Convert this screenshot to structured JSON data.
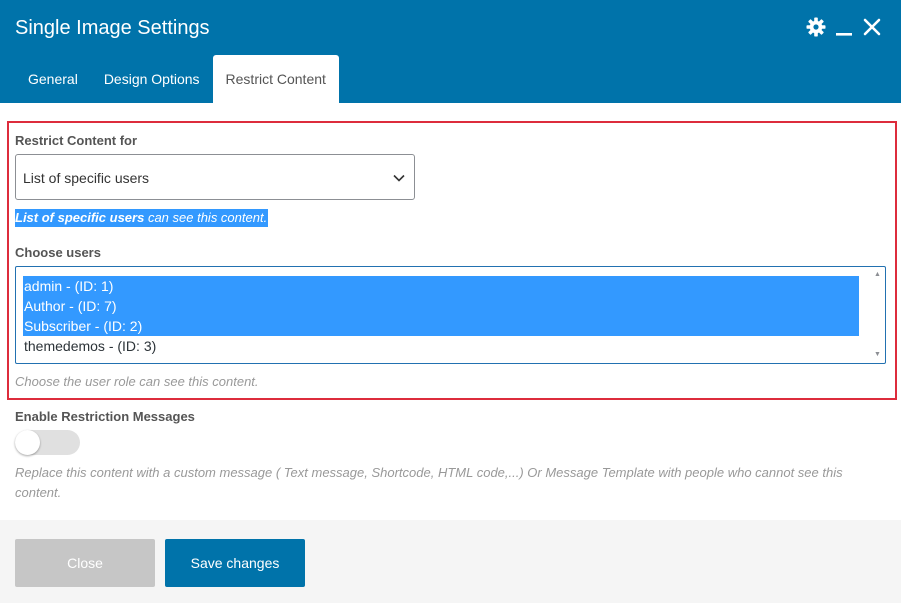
{
  "dialog": {
    "title": "Single Image Settings",
    "icons": [
      "gear-icon",
      "minimize-icon",
      "close-icon"
    ]
  },
  "tabs": [
    {
      "label": "General",
      "active": false
    },
    {
      "label": "Design Options",
      "active": false
    },
    {
      "label": "Restrict Content",
      "active": true
    }
  ],
  "restrict": {
    "label": "Restrict Content for",
    "selected": "List of specific users",
    "note_bold": "List of specific users",
    "note_rest": " can see this content."
  },
  "users": {
    "label": "Choose users",
    "options": [
      {
        "text": "admin - (ID: 1)",
        "selected": true
      },
      {
        "text": "Author - (ID: 7)",
        "selected": true
      },
      {
        "text": "Subscriber - (ID: 2)",
        "selected": true
      },
      {
        "text": "themedemos - (ID: 3)",
        "selected": false
      }
    ],
    "help": "Choose the user role can see this content."
  },
  "messages": {
    "label": "Enable Restriction Messages",
    "enabled": false,
    "help": "Replace this content with a custom message ( Text message, Shortcode, HTML code,...) Or Message Template with people who cannot see this content."
  },
  "footer": {
    "close_label": "Close",
    "save_label": "Save changes"
  },
  "colors": {
    "header": "#0073aa",
    "highlight": "#3399ff",
    "outline": "#dd2c3c"
  }
}
